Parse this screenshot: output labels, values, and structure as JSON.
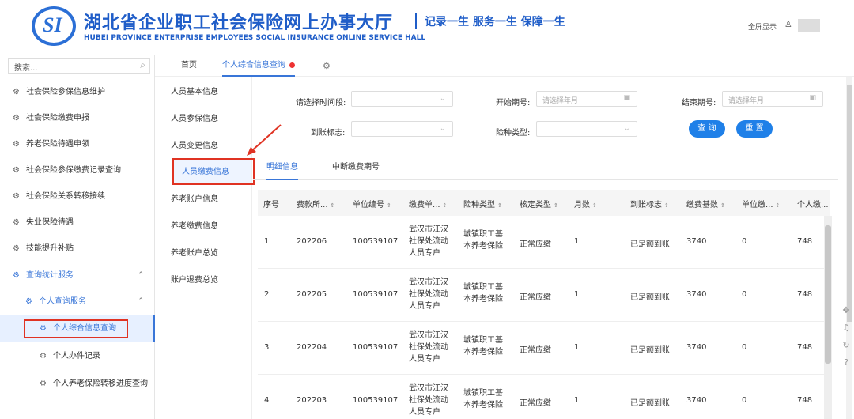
{
  "header": {
    "logo_text": "SI",
    "title": "湖北省企业职工社会保险网上办事大厅",
    "subtitle": "HUBEI PROVINCE ENTERPRISE EMPLOYEES SOCIAL INSURANCE ONLINE SERVICE HALL",
    "slogan": "记录一生 服务一生 保障一生",
    "fullscreen": "全屏显示",
    "user_icon": "user-icon"
  },
  "sidebar": {
    "search_placeholder": "搜索...",
    "items": [
      {
        "label": "社会保险参保信息维护"
      },
      {
        "label": "社会保险缴费申报"
      },
      {
        "label": "养老保险待遇申领"
      },
      {
        "label": "社会保险参保缴费记录查询"
      },
      {
        "label": "社会保险关系转移接续"
      },
      {
        "label": "失业保险待遇"
      },
      {
        "label": "技能提升补贴"
      },
      {
        "label": "查询统计服务"
      },
      {
        "label": "个人查询服务"
      },
      {
        "label": "个人综合信息查询"
      },
      {
        "label": "个人办件记录"
      },
      {
        "label": "个人养老保险转移进度查询"
      }
    ]
  },
  "tabs": {
    "home": "首页",
    "active": "个人综合信息查询"
  },
  "subnav": [
    "人员基本信息",
    "人员参保信息",
    "人员变更信息",
    "人员缴费信息",
    "养老账户信息",
    "养老缴费信息",
    "养老账户总览",
    "账户退费总览"
  ],
  "form": {
    "period_label": "请选择时间段:",
    "start_label": "开始期号:",
    "start_placeholder": "请选择年月",
    "end_label": "结束期号:",
    "end_placeholder": "请选择年月",
    "arrival_label": "到账标志:",
    "insurance_label": "险种类型:",
    "query_btn": "查 询",
    "reset_btn": "重 置"
  },
  "detail_tabs": [
    "明细信息",
    "中断缴费期号"
  ],
  "table": {
    "headers": [
      "序号",
      "费款所...",
      "单位编号",
      "缴费单...",
      "险种类型",
      "核定类型",
      "月数",
      "到账标志",
      "缴费基数",
      "单位缴...",
      "个人缴..."
    ],
    "rows": [
      [
        "1",
        "202206",
        "100539107",
        "武汉市江汉社保处流动人员专户",
        "城镇职工基本养老保险",
        "正常应缴",
        "1",
        "已足额到账",
        "3740",
        "0",
        "748"
      ],
      [
        "2",
        "202205",
        "100539107",
        "武汉市江汉社保处流动人员专户",
        "城镇职工基本养老保险",
        "正常应缴",
        "1",
        "已足额到账",
        "3740",
        "0",
        "748"
      ],
      [
        "3",
        "202204",
        "100539107",
        "武汉市江汉社保处流动人员专户",
        "城镇职工基本养老保险",
        "正常应缴",
        "1",
        "已足额到账",
        "3740",
        "0",
        "748"
      ],
      [
        "4",
        "202203",
        "100539107",
        "武汉市江汉社保处流动人员专户",
        "城镇职工基本养老保险",
        "正常应缴",
        "1",
        "已足额到账",
        "3740",
        "0",
        "748"
      ]
    ]
  },
  "colors": {
    "primary": "#3976d8",
    "highlight": "#e03323",
    "button": "#1f80e8"
  }
}
